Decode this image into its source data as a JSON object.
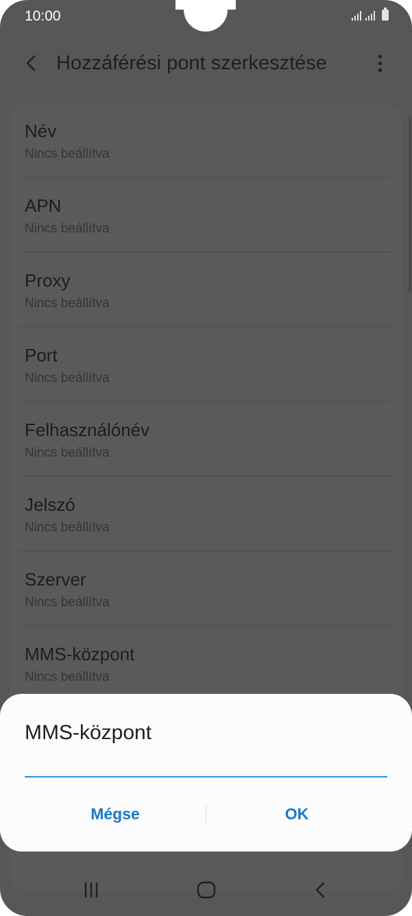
{
  "status_bar": {
    "time": "10:00"
  },
  "appbar": {
    "title": "Hozzáférési pont szerkesztése"
  },
  "apn_fields": [
    {
      "label": "Név",
      "value": "Nincs beállítva"
    },
    {
      "label": "APN",
      "value": "Nincs beállítva"
    },
    {
      "label": "Proxy",
      "value": "Nincs beállítva"
    },
    {
      "label": "Port",
      "value": "Nincs beállítva"
    },
    {
      "label": "Felhasználónév",
      "value": "Nincs beállítva"
    },
    {
      "label": "Jelszó",
      "value": "Nincs beállítva"
    },
    {
      "label": "Szerver",
      "value": "Nincs beállítva"
    },
    {
      "label": "MMS-központ",
      "value": "Nincs beállítva"
    }
  ],
  "dialog": {
    "title": "MMS-központ",
    "input_value": "",
    "cancel_label": "Mégse",
    "ok_label": "OK"
  },
  "colors": {
    "accent": "#1a79c6",
    "input_underline": "#2a8fd8",
    "scrim": "#575757",
    "dialog_bg": "#fcfcfc"
  },
  "icons": {
    "back": "chevron-left-icon",
    "more": "more-vertical-icon",
    "nav_recent": "recent-apps-icon",
    "nav_home": "home-icon",
    "nav_back": "nav-back-icon"
  }
}
